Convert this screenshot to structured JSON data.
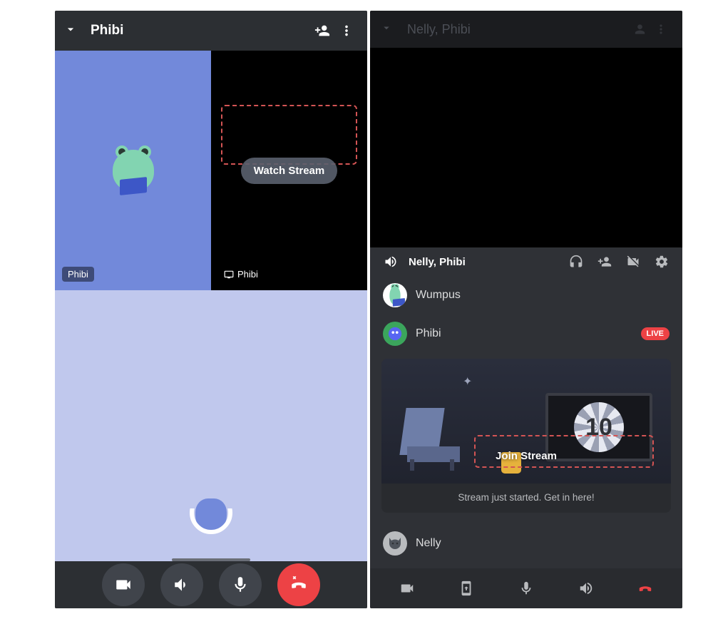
{
  "left": {
    "header": {
      "title": "Phibi"
    },
    "tiles": {
      "primary": {
        "name_tag": "Phibi"
      },
      "stream": {
        "watch_label": "Watch Stream",
        "name_tag": "Phibi",
        "name_icon": "monitor-icon"
      }
    },
    "controls": {
      "camera": "camera-icon",
      "speaker": "speaker-icon",
      "mic": "microphone-icon",
      "hangup": "hangup-icon"
    }
  },
  "right": {
    "dim_header": {
      "title": "Nelly, Phibi"
    },
    "voice_header": {
      "title": "Nelly, Phibi",
      "icons": {
        "speaker": "speaker-icon",
        "headset": "headset-icon",
        "add_user": "add-user-icon",
        "video_off": "video-off-icon",
        "settings": "gear-icon"
      }
    },
    "members": [
      {
        "name": "Wumpus",
        "avatar": "wumpus",
        "live": false
      },
      {
        "name": "Phibi",
        "avatar": "frog",
        "live": true
      }
    ],
    "live_badge": "LIVE",
    "stream_card": {
      "tv_number": "10",
      "join_label": "Join Stream",
      "caption": "Stream just started. Get in here!"
    },
    "members_after": [
      {
        "name": "Nelly",
        "avatar": "cat",
        "live": false
      }
    ],
    "bottom_bar": {
      "camera": "camera-icon",
      "screen": "screenshare-icon",
      "mic": "microphone-icon",
      "speaker": "speaker-icon",
      "hangup": "hangup-icon"
    }
  }
}
